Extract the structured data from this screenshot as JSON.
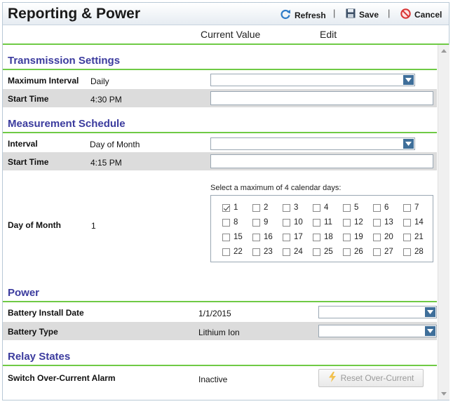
{
  "window": {
    "title": "Reporting & Power"
  },
  "toolbar": {
    "refresh_label": "Refresh",
    "save_label": "Save",
    "cancel_label": "Cancel",
    "separator": "|"
  },
  "columns": {
    "current": "Current Value",
    "edit": "Edit"
  },
  "transmission": {
    "title": "Transmission Settings",
    "max_interval_label": "Maximum Interval",
    "max_interval_value": "Daily",
    "start_time_label": "Start Time",
    "start_time_value": "4:30 PM"
  },
  "measurement": {
    "title": "Measurement Schedule",
    "interval_label": "Interval",
    "interval_value": "Day of Month",
    "start_time_label": "Start Time",
    "start_time_value": "4:15 PM",
    "day_of_month_label": "Day of Month",
    "day_of_month_value": "1",
    "calendar_note": "Select a maximum of 4 calendar days:",
    "days": [
      "1",
      "2",
      "3",
      "4",
      "5",
      "6",
      "7",
      "8",
      "9",
      "10",
      "11",
      "12",
      "13",
      "14",
      "15",
      "16",
      "17",
      "18",
      "19",
      "20",
      "21",
      "22",
      "23",
      "24",
      "25",
      "26",
      "27",
      "28"
    ],
    "checked_days": [
      "1"
    ]
  },
  "power": {
    "title": "Power",
    "install_date_label": "Battery Install Date",
    "install_date_value": "1/1/2015",
    "battery_type_label": "Battery Type",
    "battery_type_value": "Lithium Ion"
  },
  "relay": {
    "title": "Relay States",
    "alarm_label": "Switch Over-Current Alarm",
    "alarm_value": "Inactive",
    "reset_label": "Reset Over-Current"
  },
  "icons": {
    "refresh": "refresh-icon",
    "save": "save-icon",
    "cancel": "cancel-icon",
    "bolt": "lightning-icon",
    "dropdown": "chevron-down-icon"
  },
  "colors": {
    "section_title": "#3b3b9e",
    "section_rule": "#6fca45",
    "dropdown_arrow": "#3f6f9a",
    "alt_row": "#dcdcdc"
  }
}
